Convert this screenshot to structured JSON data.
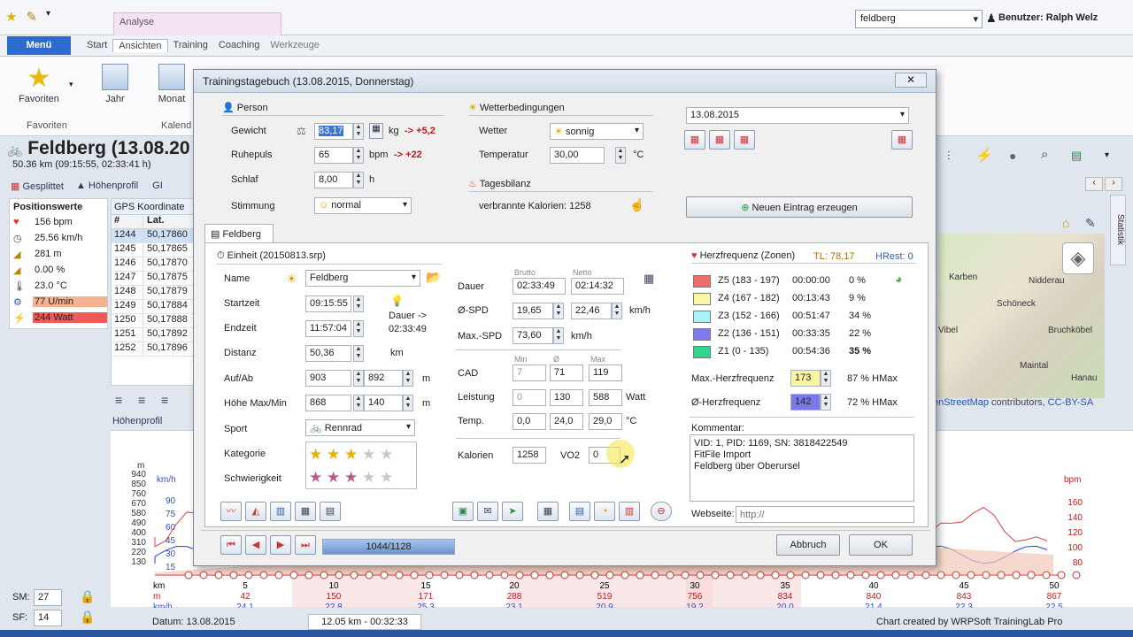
{
  "app": {
    "context_tab": "Analyse",
    "user_select": "feldberg",
    "user_label": "Benutzer: Ralph Welz",
    "menu_button": "Menü",
    "tabs": [
      "Start",
      "Ansichten",
      "Training",
      "Coaching",
      "Werkzeuge"
    ],
    "active_tab": "Ansichten",
    "ribbon": {
      "favoriten": "Favoriten",
      "favoriten_group": "Favoriten",
      "jahr": "Jahr",
      "monat": "Monat",
      "kalender_group": "Kalend"
    }
  },
  "workout": {
    "title": "Feldberg (13.08.20",
    "subtitle": "50.36 km (09:15:55, 02:33:41 h)",
    "view_tabs": [
      "Gesplittet",
      "Höhenprofil",
      "GI"
    ]
  },
  "positionswerte": {
    "title": "Positionswerte",
    "items": [
      {
        "icon": "heart-icon",
        "value": "156 bpm",
        "bg": "#fff"
      },
      {
        "icon": "speed-icon",
        "value": "25.56 km/h",
        "bg": "#fff"
      },
      {
        "icon": "altitude-icon",
        "value": "281 m",
        "bg": "#fff"
      },
      {
        "icon": "slope-icon",
        "value": "0.00 %",
        "bg": "#fff"
      },
      {
        "icon": "temperature-icon",
        "value": "23.0 °C",
        "bg": "#fff"
      },
      {
        "icon": "cadence-icon",
        "value": "77 U/min",
        "bg": "#f5b28e"
      },
      {
        "icon": "power-icon",
        "value": "244 Watt",
        "bg": "#ef5a5a"
      }
    ]
  },
  "gps": {
    "title": "GPS Koordinate",
    "col_hash": "#",
    "col_lat": "Lat.",
    "rows": [
      [
        "1244",
        "50,17860"
      ],
      [
        "1245",
        "50,17865"
      ],
      [
        "1246",
        "50,17870"
      ],
      [
        "1247",
        "50,17875"
      ],
      [
        "1248",
        "50,17879"
      ],
      [
        "1249",
        "50,17884"
      ],
      [
        "1250",
        "50,17888"
      ],
      [
        "1251",
        "50,17892"
      ],
      [
        "1252",
        "50,17896"
      ]
    ]
  },
  "hoehenprofil_label": "Höhenprofil",
  "map": {
    "labels": [
      "Karben",
      "Nidderau",
      "Schöneck",
      "Bruchköbel",
      "Maintal",
      "Hanau",
      "Vibel"
    ],
    "attribution_link": "enStreetMap",
    "attribution_text": "contributors,",
    "license": "CC-BY-SA",
    "statistik": "Statistik"
  },
  "bottom": {
    "sm_label": "SM:",
    "sm_value": "27",
    "sf_label": "SF:",
    "sf_value": "14",
    "datum": "Datum: 13.08.2015",
    "cursor_info": "12.05 km - 00:32:33",
    "chart_credit": "Chart created by WRPSoft TrainingLab Pro",
    "y_unit_m": "m",
    "y_unit_kmh": "km/h",
    "y_unit_bpm": "bpm"
  },
  "dialog": {
    "title": "Trainingstagebuch (13.08.2015, Donnerstag)",
    "close": "✕",
    "person": {
      "section": "Person",
      "gewicht_label": "Gewicht",
      "gewicht": "83,17",
      "gewicht_unit": "kg",
      "gewicht_delta": "-> +5,2",
      "ruhepuls_label": "Ruhepuls",
      "ruhepuls": "65",
      "ruhepuls_unit": "bpm",
      "ruhepuls_delta": "-> +22",
      "schlaf_label": "Schlaf",
      "schlaf": "8,00",
      "schlaf_unit": "h",
      "stimmung_label": "Stimmung",
      "stimmung": "normal"
    },
    "wetter": {
      "section": "Wetterbedingungen",
      "wetter_label": "Wetter",
      "wetter": "sonnig",
      "temperatur_label": "Temperatur",
      "temperatur": "30,00",
      "temperatur_unit": "°C",
      "bilanz_section": "Tagesbilanz",
      "kalorien": "verbrannte Kalorien: 1258"
    },
    "date": "13.08.2015",
    "new_entry": "Neuen Eintrag erzeugen",
    "tab": "Feldberg",
    "einheit": {
      "section": "Einheit (20150813.srp)",
      "name_label": "Name",
      "name": "Feldberg",
      "startzeit_label": "Startzeit",
      "startzeit": "09:15:55",
      "endzeit_label": "Endzeit",
      "endzeit": "11:57:04",
      "dauer_note": "Dauer ->",
      "dauer_note_val": "02:33:49",
      "distanz_label": "Distanz",
      "distanz": "50,36",
      "distanz_unit": "km",
      "aufab_label": "Auf/Ab",
      "auf": "903",
      "ab": "892",
      "aufab_unit": "m",
      "hoehe_label": "Höhe Max/Min",
      "hoehe_max": "868",
      "hoehe_min": "140",
      "hoehe_unit": "m",
      "sport_label": "Sport",
      "sport": "Rennrad",
      "kategorie_label": "Kategorie",
      "kategorie_stars": 3,
      "schwierigkeit_label": "Schwierigkeit",
      "schwierigkeit_stars": 3
    },
    "werte": {
      "brutto": "Brutto",
      "netto": "Netto",
      "dauer_label": "Dauer",
      "dauer_brutto": "02:33:49",
      "dauer_netto": "02:14:32",
      "spd_label": "Ø-SPD",
      "spd_brutto": "19,65",
      "spd_netto": "22,46",
      "spd_unit": "km/h",
      "maxspd_label": "Max.-SPD",
      "maxspd": "73,60",
      "maxspd_unit": "km/h",
      "min": "Min",
      "avg": "Ø",
      "max": "Max",
      "cad_label": "CAD",
      "cad_min": "7",
      "cad_avg": "71",
      "cad_max": "119",
      "leistung_label": "Leistung",
      "leistung_min": "0",
      "leistung_avg": "130",
      "leistung_max": "588",
      "leistung_unit": "Watt",
      "temp_label": "Temp.",
      "temp_min": "0,0",
      "temp_avg": "24,0",
      "temp_max": "29,0",
      "temp_unit": "°C",
      "kalorien_label": "Kalorien",
      "kalorien": "1258",
      "vo2_label": "VO2",
      "vo2": "0"
    },
    "hf": {
      "section": "Herzfrequenz (Zonen)",
      "tl": "TL: 78,17",
      "hrest": "HRest: 0",
      "zones": [
        {
          "name": "Z5 (183 - 197)",
          "time": "00:00:00",
          "pct": "0 %",
          "color": "#f26b6b"
        },
        {
          "name": "Z4 (167 - 182)",
          "time": "00:13:43",
          "pct": "9 %",
          "color": "#fbf7a6"
        },
        {
          "name": "Z3 (152 - 166)",
          "time": "00:51:47",
          "pct": "34 %",
          "color": "#a8f3f5"
        },
        {
          "name": "Z2 (136 - 151)",
          "time": "00:33:35",
          "pct": "22 %",
          "color": "#7f79ef"
        },
        {
          "name": "Z1 (0 - 135)",
          "time": "00:54:36",
          "pct": "35 %",
          "color": "#2fd68d"
        }
      ],
      "max_label": "Max.-Herzfrequenz",
      "max": "173",
      "max_pct": "87 % HMax",
      "avg_label": "Ø-Herzfrequenz",
      "avg": "142",
      "avg_pct": "72 % HMax"
    },
    "kommentar": {
      "label": "Kommentar:",
      "lines": [
        "VID: 1, PID: 1169, SN: 3818422549",
        "FitFile Import",
        "Feldberg über Oberursel"
      ]
    },
    "webseite_label": "Webseite:",
    "webseite_placeholder": "http://",
    "nav_counter": "1044/1128",
    "abbruch": "Abbruch",
    "ok": "OK"
  },
  "chart_data": {
    "type": "line",
    "x_label_km": "km",
    "km_ticks": [
      "5",
      "10",
      "15",
      "20",
      "25",
      "30",
      "35",
      "40",
      "45",
      "50"
    ],
    "m_row_label": "m",
    "m_values": [
      "42",
      "150",
      "171",
      "288",
      "519",
      "756",
      "834",
      "840",
      "843",
      "867"
    ],
    "kmh_row_label": "km/h",
    "kmh_values": [
      "24.1",
      "22.8",
      "25.3",
      "23.1",
      "20.9",
      "19.2",
      "20.0",
      "21.4",
      "22.3",
      "22.5"
    ],
    "y_m_ticks": [
      "940",
      "850",
      "760",
      "670",
      "580",
      "490",
      "400",
      "310",
      "220",
      "130"
    ],
    "y_kmh_ticks": [
      "90",
      "75",
      "60",
      "45",
      "30",
      "15"
    ],
    "y_bpm_ticks": [
      "160",
      "140",
      "120",
      "100",
      "80"
    ]
  }
}
